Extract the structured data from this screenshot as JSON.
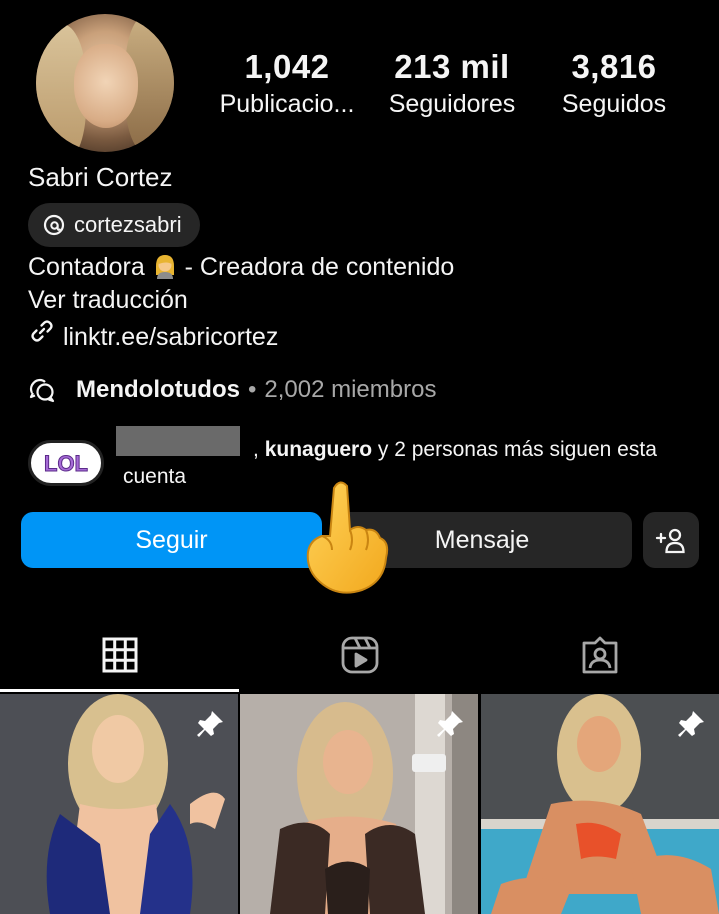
{
  "profile": {
    "name": "Sabri Cortez",
    "threads_handle": "cortezsabri",
    "bio_line1_a": "Contadora",
    "bio_line1_b": "- Creadora de contenido",
    "bio_line2": "Ver traducción",
    "link": "linktr.ee/sabricortez"
  },
  "stats": [
    {
      "value": "1,042",
      "label": "Publicacio..."
    },
    {
      "value": "213 mil",
      "label": "Seguidores"
    },
    {
      "value": "3,816",
      "label": "Seguidos"
    }
  ],
  "community": {
    "name": "Mendolotudos",
    "separator": "•",
    "members": "2,002 miembros"
  },
  "followed_by": {
    "comma": ",",
    "user": "kunaguero",
    "rest_line1": " y 2 personas más siguen esta",
    "line2": "cuenta",
    "badge_text": "LOL"
  },
  "buttons": {
    "follow": "Seguir",
    "message": "Mensaje"
  },
  "icons": {
    "threads": "threads-icon",
    "link": "link-icon",
    "community": "community-chat-icon",
    "add_person": "add-person-icon",
    "grid_tab": "grid-icon",
    "reels_tab": "reels-icon",
    "tagged_tab": "tagged-icon",
    "pin": "pin-icon",
    "pointing_hand": "pointing-up-hand-emoji"
  },
  "colors": {
    "background": "#000000",
    "follow_button": "#0095f6",
    "secondary_button": "#262626",
    "muted_text": "#a8a8a8"
  }
}
